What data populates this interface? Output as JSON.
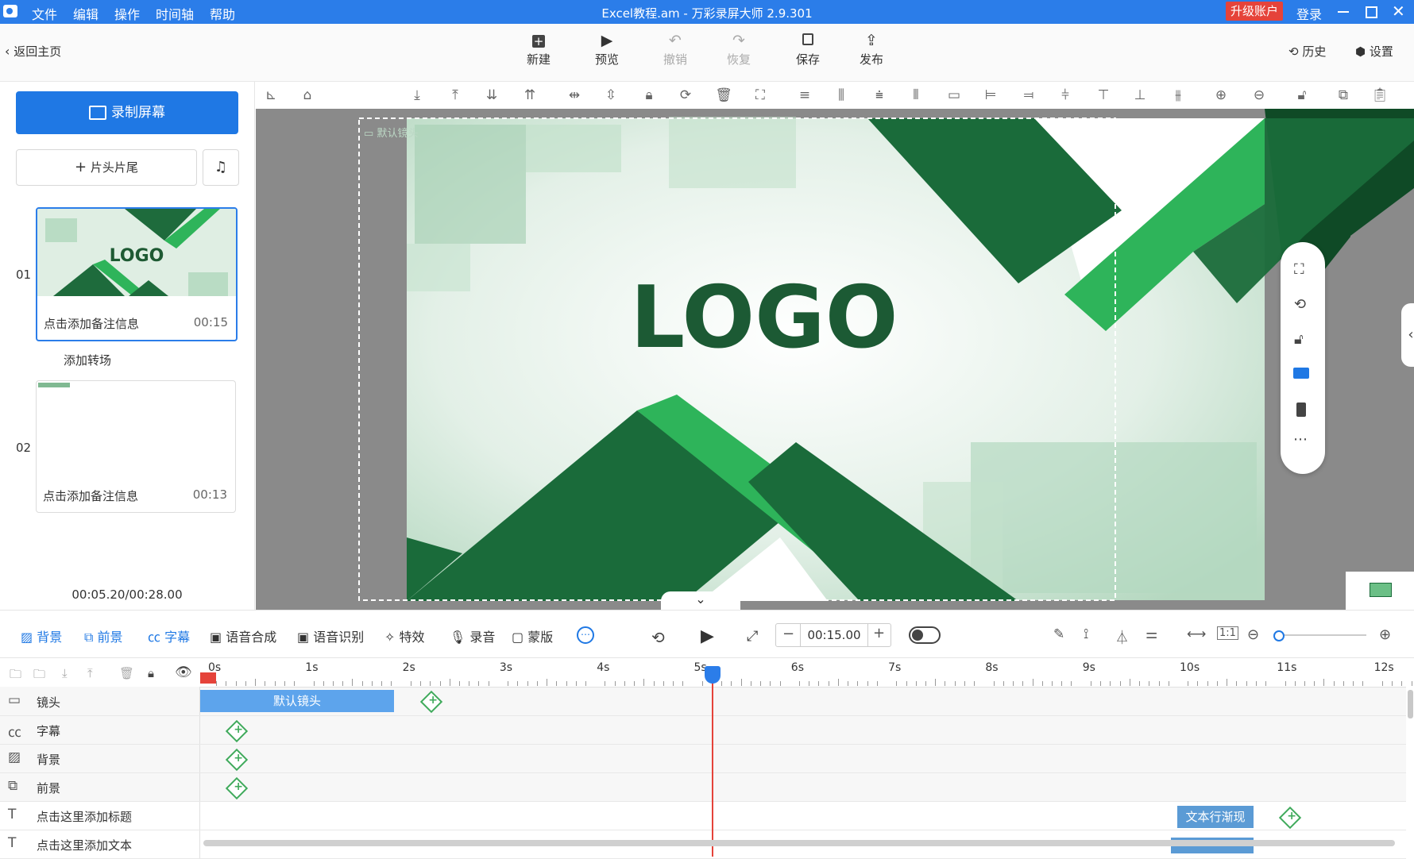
{
  "app": {
    "window_title": "Excel教程.am - 万彩录屏大师 2.9.301",
    "menu": [
      "文件",
      "编辑",
      "操作",
      "时间轴",
      "帮助"
    ],
    "upgrade_label": "升级账户",
    "login_label": "登录"
  },
  "toolbar": {
    "back_label": "返回主页",
    "buttons": [
      {
        "label": "新建",
        "icon": "plus-square-icon",
        "enabled": true
      },
      {
        "label": "预览",
        "icon": "play-icon",
        "enabled": true
      },
      {
        "label": "撤销",
        "icon": "undo-icon",
        "enabled": false
      },
      {
        "label": "恢复",
        "icon": "redo-icon",
        "enabled": false
      },
      {
        "label": "保存",
        "icon": "save-icon",
        "enabled": true
      },
      {
        "label": "发布",
        "icon": "publish-icon",
        "enabled": true
      }
    ],
    "history_label": "历史",
    "settings_label": "设置"
  },
  "left_panel": {
    "record_label": "录制屏幕",
    "head_tail_label": "片头片尾",
    "add_transition_label": "添加转场",
    "slides": [
      {
        "number": "01",
        "note": "点击添加备注信息",
        "duration": "00:15",
        "thumb_text": "LOGO"
      },
      {
        "number": "02",
        "note": "点击添加备注信息",
        "duration": "00:13",
        "thumb_text": ""
      }
    ],
    "time_readout": "00:05.20/00:28.00"
  },
  "canvas": {
    "camera_label": "默认镜头",
    "logo_text": "LOGO",
    "colors": {
      "dark_green": "#1e6b3c",
      "bright_green": "#2eb45a",
      "bg_light": "#d9ebdf"
    }
  },
  "bottom_tabs": {
    "items": [
      {
        "label": "背景",
        "blue": true
      },
      {
        "label": "前景",
        "blue": true
      },
      {
        "label": "字幕",
        "blue": true
      },
      {
        "label": "语音合成",
        "blue": false
      },
      {
        "label": "语音识别",
        "blue": false
      },
      {
        "label": "特效",
        "blue": false
      },
      {
        "label": "录音",
        "blue": false
      },
      {
        "label": "蒙版",
        "blue": false
      }
    ],
    "time_value": "00:15.00"
  },
  "timeline": {
    "ruler": [
      "0s",
      "1s",
      "2s",
      "3s",
      "4s",
      "5s",
      "6s",
      "7s",
      "8s",
      "9s",
      "10s",
      "11s",
      "12s"
    ],
    "playhead_seconds": 5.2,
    "tracks": [
      {
        "label": "镜头"
      },
      {
        "label": "字幕"
      },
      {
        "label": "背景"
      },
      {
        "label": "前景"
      },
      {
        "label": "点击这里添加标题"
      },
      {
        "label": "点击这里添加文本"
      }
    ],
    "camera_block_label": "默认镜头",
    "text_block_label": "文本行渐现"
  }
}
